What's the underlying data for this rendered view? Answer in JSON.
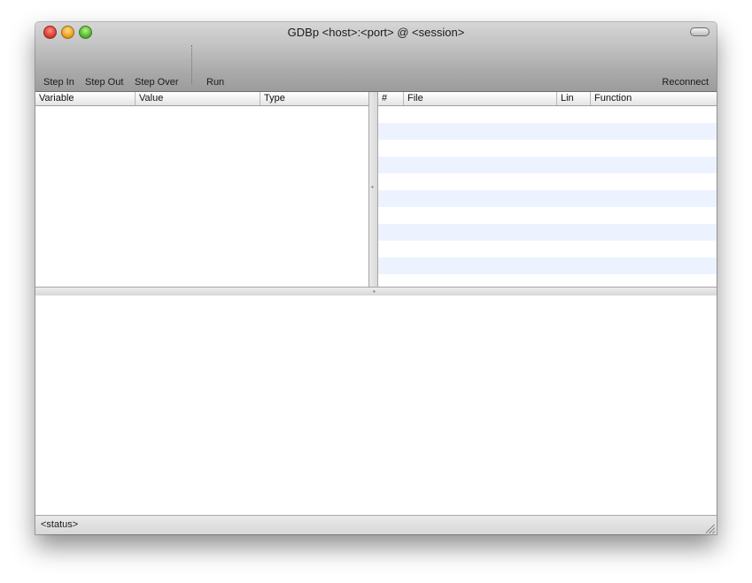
{
  "window": {
    "title": "GDBp <host>:<port> @ <session>"
  },
  "toolbar": {
    "step_in": "Step In",
    "step_out": "Step Out",
    "step_over": "Step Over",
    "run": "Run",
    "reconnect": "Reconnect"
  },
  "variables_table": {
    "columns": [
      "Variable",
      "Value",
      "Type"
    ],
    "rows": []
  },
  "stack_table": {
    "columns": [
      "#",
      "File",
      "Lin",
      "Function"
    ],
    "rows": []
  },
  "status": {
    "text": "<status>"
  },
  "colors": {
    "row_stripe": "#edf3fe",
    "titlebar_top": "#d6d6d6",
    "titlebar_bottom": "#9c9c9c"
  },
  "icons": [
    "close-icon",
    "minimize-icon",
    "zoom-icon",
    "toolbar-toggle-icon",
    "resize-grip-icon"
  ]
}
